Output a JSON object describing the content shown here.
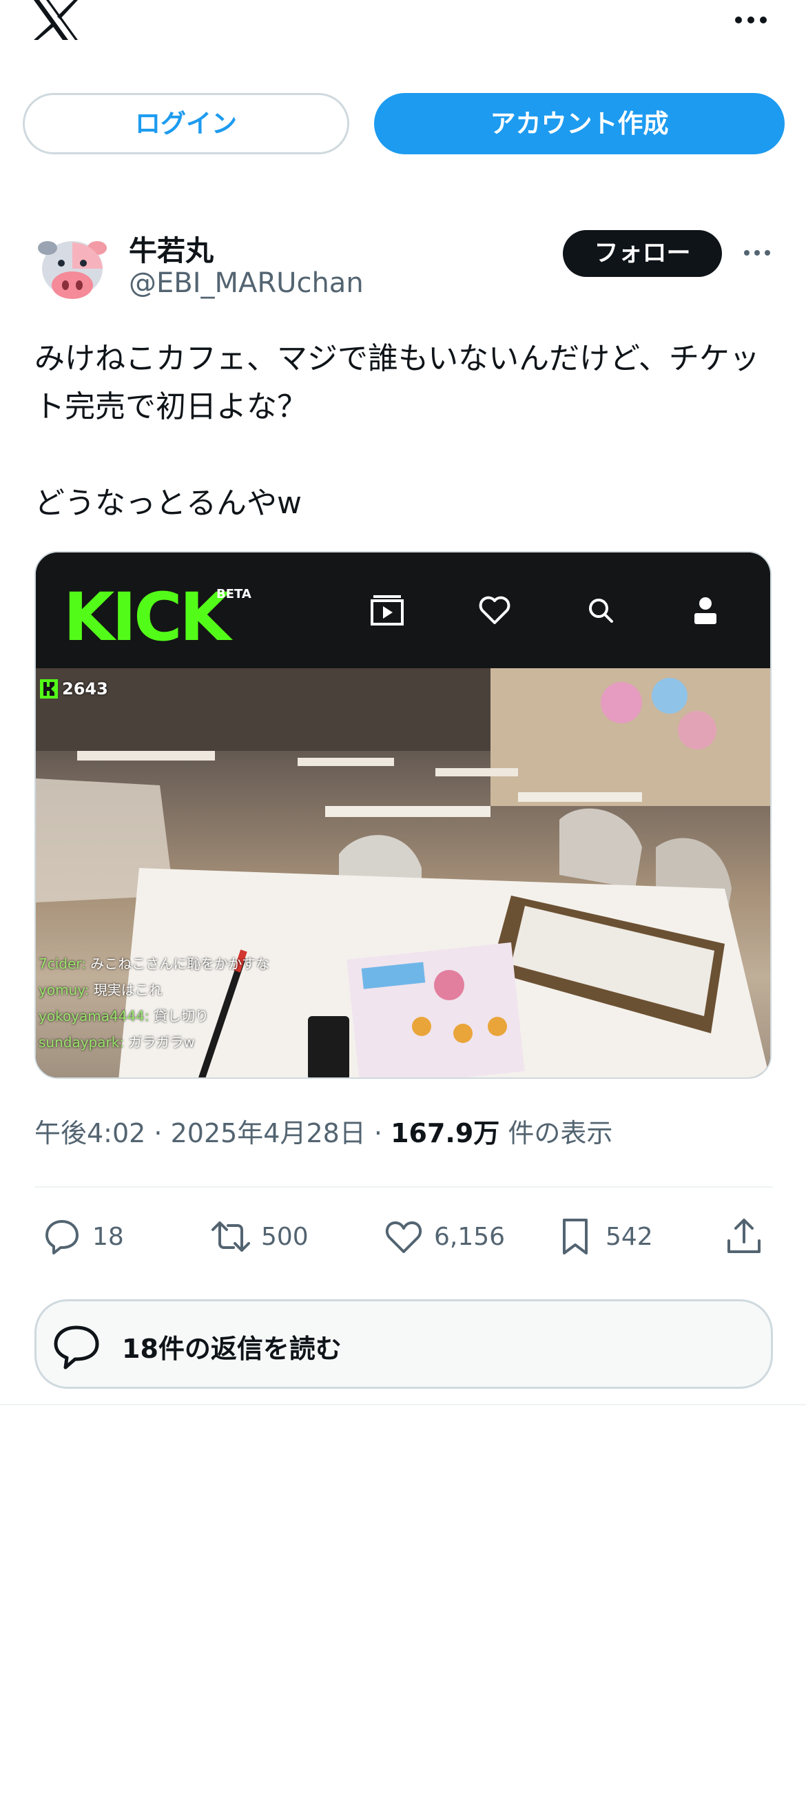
{
  "top": {
    "logo_icon": "x-logo-icon",
    "more_icon": "more-horizontal-icon"
  },
  "auth": {
    "login_label": "ログイン",
    "signup_label": "アカウント作成"
  },
  "tweet": {
    "author_name": "牛若丸",
    "author_handle": "@EBI_MARUchan",
    "follow_label": "フォロー",
    "text": "みけねこカフェ、マジで誰もいないんだけど、チケット完売で初日よな？\n\nどうなっとるんやw",
    "media": {
      "brand": "KICK",
      "brand_tag": "BETA",
      "viewer_count": "2643",
      "chat": [
        {
          "user": "7cider:",
          "message": "みこねこさんに恥をかかすな"
        },
        {
          "user": "yomuy:",
          "message": "現実はこれ"
        },
        {
          "user": "yokoyama4444:",
          "message": "貸し切り"
        },
        {
          "user": "sundaypark:",
          "message": "ガラガラw"
        }
      ]
    },
    "time": "午後4:02",
    "date": "2025年4月28日",
    "views": "167.9万",
    "views_suffix": "件の表示",
    "stats": {
      "replies": "18",
      "retweets": "500",
      "likes": "6,156",
      "bookmarks": "542"
    },
    "read_replies_label": "18件の返信を読む"
  },
  "colors": {
    "accent": "#1d9bf0",
    "text": "#0f1419",
    "muted": "#536471",
    "kick_green": "#53fc18"
  }
}
